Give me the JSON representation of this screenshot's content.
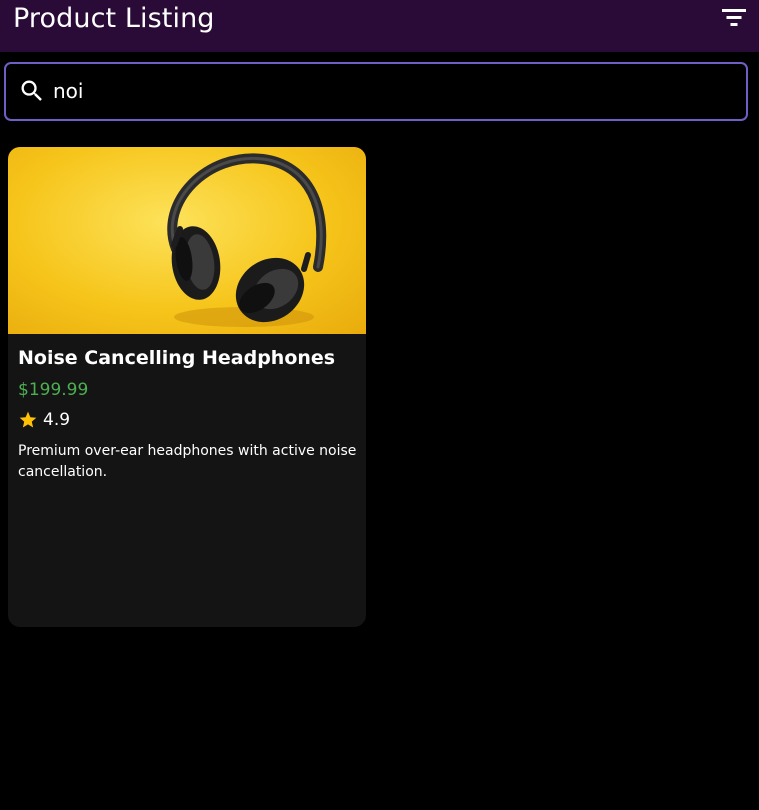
{
  "appbar": {
    "title": "Product Listing",
    "filter_icon": "filter-list-icon"
  },
  "search": {
    "icon": "search-icon",
    "value": "noi",
    "border_color": "#6f5fc4"
  },
  "products": [
    {
      "image": "headphones-photo",
      "name": "Noise Cancelling Headphones",
      "price": "$199.99",
      "rating_icon": "star-icon",
      "rating": "4.9",
      "description": "Premium over-ear headphones with active noise cancellation."
    }
  ],
  "colors": {
    "appbar": "#2a0a36",
    "background": "#000000",
    "card": "#141414",
    "price": "#4caf50",
    "star": "#ffc107"
  }
}
